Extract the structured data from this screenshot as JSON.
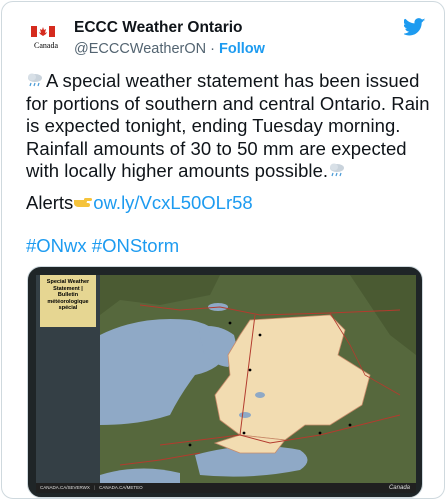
{
  "account": {
    "display_name": "ECCC Weather Ontario",
    "handle": "@ECCCWeatherON",
    "separator": "·",
    "follow_label": "Follow",
    "avatar_text": "Canada"
  },
  "tweet": {
    "body": "A special weather statement has been issued for portions of southern and central Ontario. Rain is expected tonight, ending Tuesday morning. Rainfall amounts of 30 to 50 mm are expected with locally higher amounts possible.",
    "alerts_label": "Alerts",
    "alerts_link": "ow.ly/VcxL50OLr58",
    "hashtags": "#ONwx #ONStorm"
  },
  "map": {
    "statement_lines": [
      "Special Weather",
      "Statement |",
      "Bulletin",
      "météorologique",
      "spécial"
    ],
    "footer_left": "CANADA.CA/SEVERWX",
    "footer_mid": "CANADA.CA/METEO",
    "footer_logo": "Canada",
    "colors": {
      "alert_region": "#f2dcb1",
      "water": "#8fa9c6",
      "land": "#5a6b3f",
      "roads": "#b33b2e"
    }
  },
  "icons": [
    "cloud-rain-icon",
    "twitter-bird-icon",
    "pointing-hand-icon",
    "canada-flag-icon"
  ],
  "colors": {
    "accent": "#1d9bf0",
    "text": "#0f1419",
    "secondary_text": "#536471",
    "border": "#cfd9de"
  }
}
